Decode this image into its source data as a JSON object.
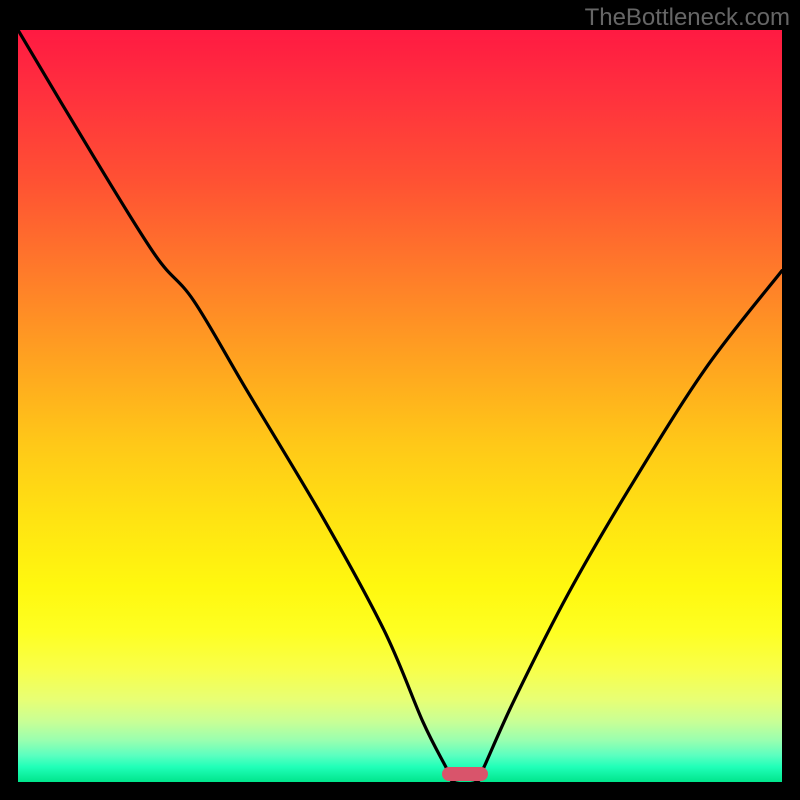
{
  "watermark": "TheBottleneck.com",
  "chart_data": {
    "type": "line",
    "title": "",
    "xlabel": "",
    "ylabel": "",
    "xlim": [
      0,
      100
    ],
    "ylim": [
      0,
      100
    ],
    "curve_points": [
      {
        "x": 0,
        "y": 100
      },
      {
        "x": 10,
        "y": 83
      },
      {
        "x": 18,
        "y": 70
      },
      {
        "x": 23,
        "y": 64
      },
      {
        "x": 30,
        "y": 52
      },
      {
        "x": 40,
        "y": 35
      },
      {
        "x": 48,
        "y": 20
      },
      {
        "x": 53,
        "y": 8
      },
      {
        "x": 56,
        "y": 2
      },
      {
        "x": 57,
        "y": 0
      },
      {
        "x": 60,
        "y": 0
      },
      {
        "x": 61,
        "y": 2
      },
      {
        "x": 65,
        "y": 11
      },
      {
        "x": 72,
        "y": 25
      },
      {
        "x": 80,
        "y": 39
      },
      {
        "x": 90,
        "y": 55
      },
      {
        "x": 100,
        "y": 68
      }
    ],
    "optimal_marker": {
      "x": 58.5,
      "width": 6
    },
    "gradient_stops": [
      {
        "pos": 0,
        "color": "#ff1a42"
      },
      {
        "pos": 50,
        "color": "#ffc818"
      },
      {
        "pos": 80,
        "color": "#feff22"
      },
      {
        "pos": 100,
        "color": "#00e58c"
      }
    ]
  }
}
